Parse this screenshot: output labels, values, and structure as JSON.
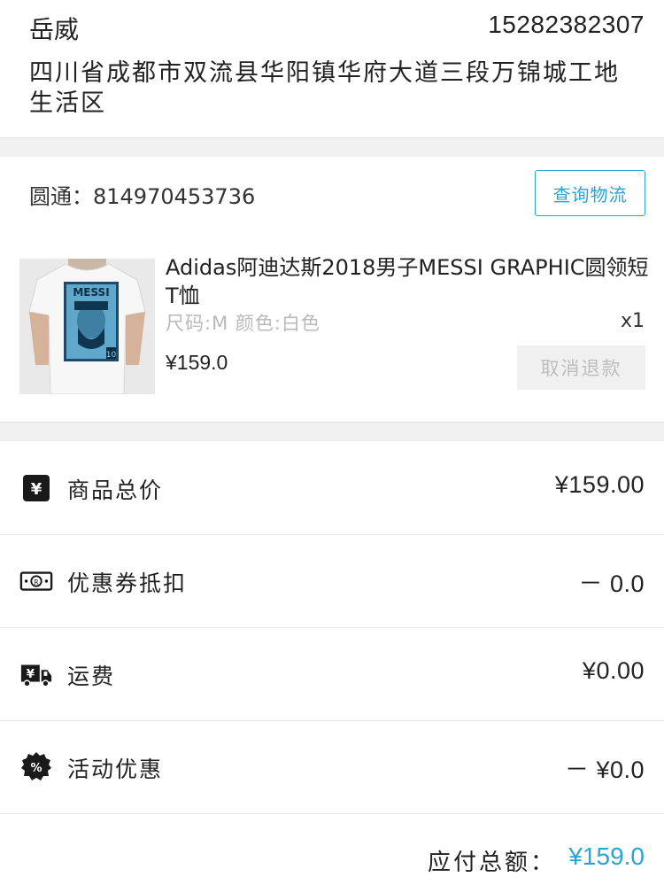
{
  "address": {
    "name": "岳威",
    "phone": "15282382307",
    "detail": "四川省成都市双流县华阳镇华府大道三段万锦城工地生活区"
  },
  "logistics": {
    "tracking_text": "圆通：814970453736",
    "query_button": "查询物流"
  },
  "product": {
    "title": "Adidas阿迪达斯2018男子MESSI GRAPHIC圆领短T恤",
    "spec": "尺码:M 颜色:白色",
    "quantity": "x1",
    "price": "¥159.0",
    "cancel_refund_button": "取消退款",
    "image_shirt_text": "MESSI",
    "image_number": "10"
  },
  "summary": [
    {
      "icon": "yen-square-icon",
      "label": "商品总价",
      "value": "¥159.00"
    },
    {
      "icon": "coupon-ticket-icon",
      "label": "优惠券抵扣",
      "value": "－ 0.0"
    },
    {
      "icon": "delivery-truck-icon",
      "label": "运费",
      "value": "¥0.00"
    },
    {
      "icon": "percent-badge-icon",
      "label": "活动优惠",
      "value": "－ ¥0.0"
    }
  ],
  "total": {
    "label": "应付总额：",
    "value": "¥159.0"
  },
  "colors": {
    "accent": "#2aa4d6",
    "muted": "#b9b9b9",
    "separator_bg": "#f1f1f1"
  }
}
